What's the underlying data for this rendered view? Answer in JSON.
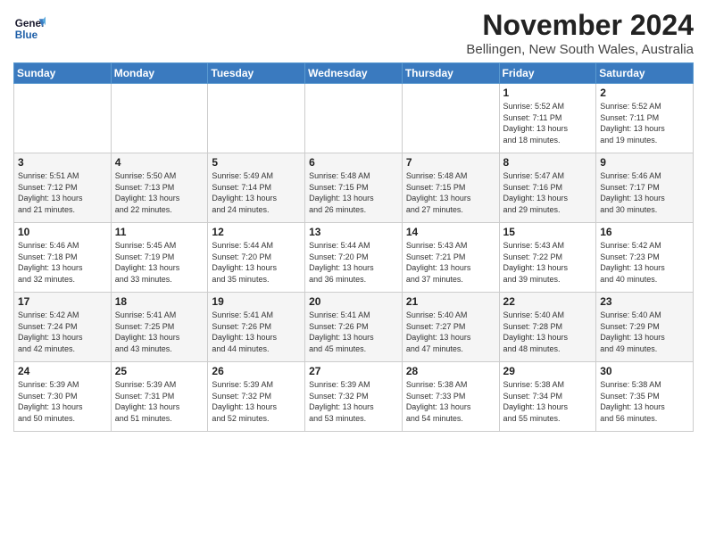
{
  "app": {
    "name": "GeneralBlue",
    "logo_line1": "General",
    "logo_line2": "Blue"
  },
  "header": {
    "month_year": "November 2024",
    "location": "Bellingen, New South Wales, Australia"
  },
  "weekdays": [
    "Sunday",
    "Monday",
    "Tuesday",
    "Wednesday",
    "Thursday",
    "Friday",
    "Saturday"
  ],
  "weeks": [
    [
      {
        "day": "",
        "info": ""
      },
      {
        "day": "",
        "info": ""
      },
      {
        "day": "",
        "info": ""
      },
      {
        "day": "",
        "info": ""
      },
      {
        "day": "",
        "info": ""
      },
      {
        "day": "1",
        "info": "Sunrise: 5:52 AM\nSunset: 7:11 PM\nDaylight: 13 hours\nand 18 minutes."
      },
      {
        "day": "2",
        "info": "Sunrise: 5:52 AM\nSunset: 7:11 PM\nDaylight: 13 hours\nand 19 minutes."
      }
    ],
    [
      {
        "day": "3",
        "info": "Sunrise: 5:51 AM\nSunset: 7:12 PM\nDaylight: 13 hours\nand 21 minutes."
      },
      {
        "day": "4",
        "info": "Sunrise: 5:50 AM\nSunset: 7:13 PM\nDaylight: 13 hours\nand 22 minutes."
      },
      {
        "day": "5",
        "info": "Sunrise: 5:49 AM\nSunset: 7:14 PM\nDaylight: 13 hours\nand 24 minutes."
      },
      {
        "day": "6",
        "info": "Sunrise: 5:48 AM\nSunset: 7:15 PM\nDaylight: 13 hours\nand 26 minutes."
      },
      {
        "day": "7",
        "info": "Sunrise: 5:48 AM\nSunset: 7:15 PM\nDaylight: 13 hours\nand 27 minutes."
      },
      {
        "day": "8",
        "info": "Sunrise: 5:47 AM\nSunset: 7:16 PM\nDaylight: 13 hours\nand 29 minutes."
      },
      {
        "day": "9",
        "info": "Sunrise: 5:46 AM\nSunset: 7:17 PM\nDaylight: 13 hours\nand 30 minutes."
      }
    ],
    [
      {
        "day": "10",
        "info": "Sunrise: 5:46 AM\nSunset: 7:18 PM\nDaylight: 13 hours\nand 32 minutes."
      },
      {
        "day": "11",
        "info": "Sunrise: 5:45 AM\nSunset: 7:19 PM\nDaylight: 13 hours\nand 33 minutes."
      },
      {
        "day": "12",
        "info": "Sunrise: 5:44 AM\nSunset: 7:20 PM\nDaylight: 13 hours\nand 35 minutes."
      },
      {
        "day": "13",
        "info": "Sunrise: 5:44 AM\nSunset: 7:20 PM\nDaylight: 13 hours\nand 36 minutes."
      },
      {
        "day": "14",
        "info": "Sunrise: 5:43 AM\nSunset: 7:21 PM\nDaylight: 13 hours\nand 37 minutes."
      },
      {
        "day": "15",
        "info": "Sunrise: 5:43 AM\nSunset: 7:22 PM\nDaylight: 13 hours\nand 39 minutes."
      },
      {
        "day": "16",
        "info": "Sunrise: 5:42 AM\nSunset: 7:23 PM\nDaylight: 13 hours\nand 40 minutes."
      }
    ],
    [
      {
        "day": "17",
        "info": "Sunrise: 5:42 AM\nSunset: 7:24 PM\nDaylight: 13 hours\nand 42 minutes."
      },
      {
        "day": "18",
        "info": "Sunrise: 5:41 AM\nSunset: 7:25 PM\nDaylight: 13 hours\nand 43 minutes."
      },
      {
        "day": "19",
        "info": "Sunrise: 5:41 AM\nSunset: 7:26 PM\nDaylight: 13 hours\nand 44 minutes."
      },
      {
        "day": "20",
        "info": "Sunrise: 5:41 AM\nSunset: 7:26 PM\nDaylight: 13 hours\nand 45 minutes."
      },
      {
        "day": "21",
        "info": "Sunrise: 5:40 AM\nSunset: 7:27 PM\nDaylight: 13 hours\nand 47 minutes."
      },
      {
        "day": "22",
        "info": "Sunrise: 5:40 AM\nSunset: 7:28 PM\nDaylight: 13 hours\nand 48 minutes."
      },
      {
        "day": "23",
        "info": "Sunrise: 5:40 AM\nSunset: 7:29 PM\nDaylight: 13 hours\nand 49 minutes."
      }
    ],
    [
      {
        "day": "24",
        "info": "Sunrise: 5:39 AM\nSunset: 7:30 PM\nDaylight: 13 hours\nand 50 minutes."
      },
      {
        "day": "25",
        "info": "Sunrise: 5:39 AM\nSunset: 7:31 PM\nDaylight: 13 hours\nand 51 minutes."
      },
      {
        "day": "26",
        "info": "Sunrise: 5:39 AM\nSunset: 7:32 PM\nDaylight: 13 hours\nand 52 minutes."
      },
      {
        "day": "27",
        "info": "Sunrise: 5:39 AM\nSunset: 7:32 PM\nDaylight: 13 hours\nand 53 minutes."
      },
      {
        "day": "28",
        "info": "Sunrise: 5:38 AM\nSunset: 7:33 PM\nDaylight: 13 hours\nand 54 minutes."
      },
      {
        "day": "29",
        "info": "Sunrise: 5:38 AM\nSunset: 7:34 PM\nDaylight: 13 hours\nand 55 minutes."
      },
      {
        "day": "30",
        "info": "Sunrise: 5:38 AM\nSunset: 7:35 PM\nDaylight: 13 hours\nand 56 minutes."
      }
    ]
  ]
}
